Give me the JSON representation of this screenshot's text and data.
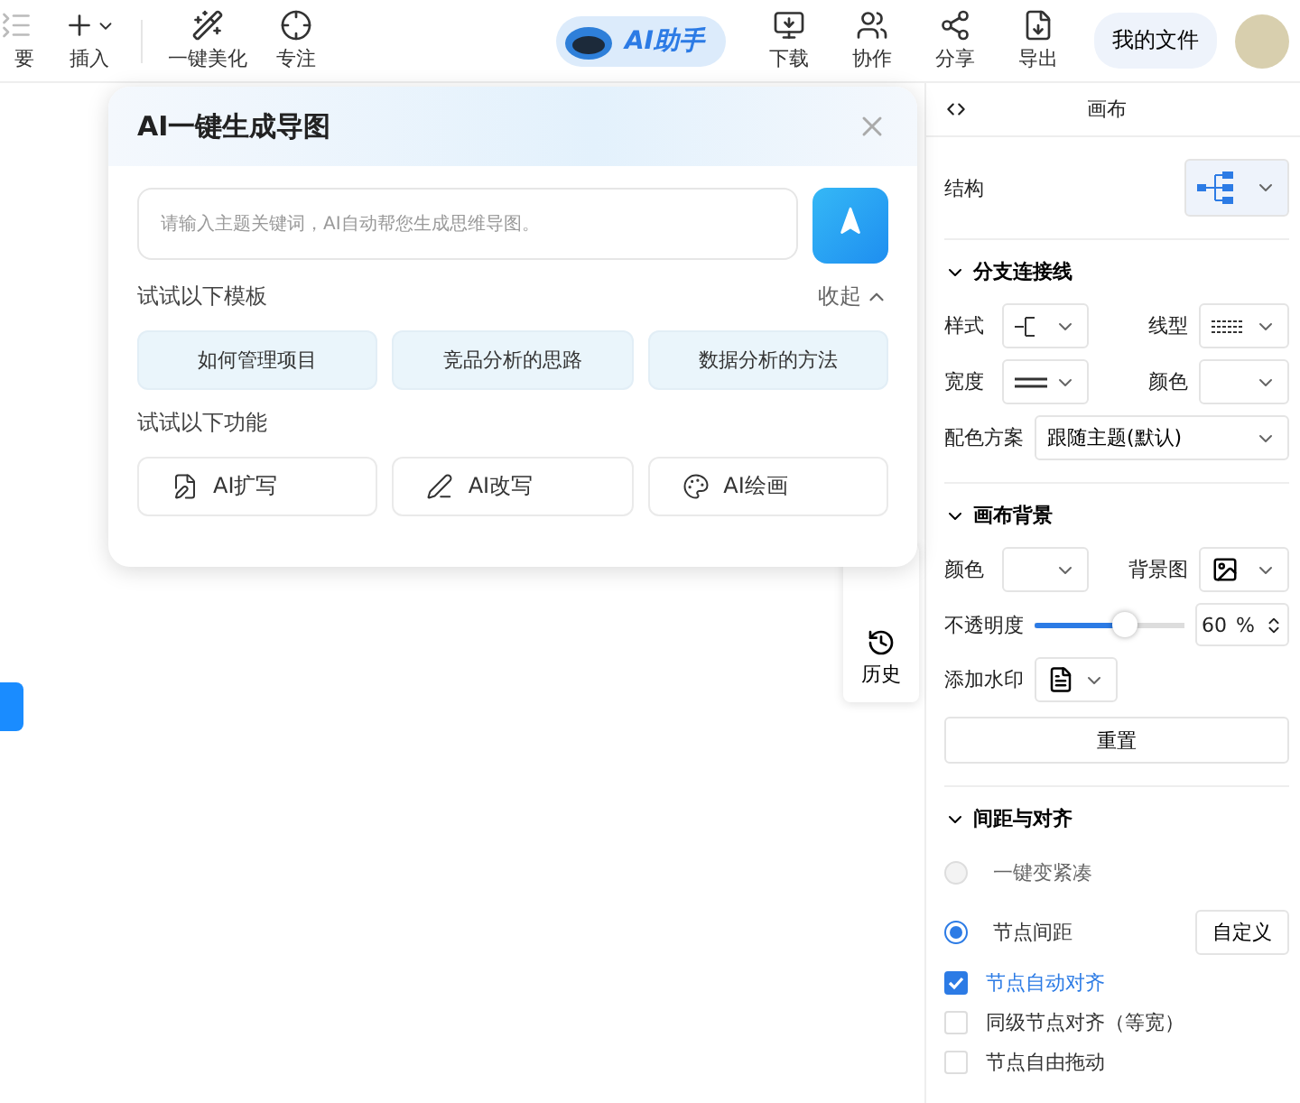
{
  "toolbar": {
    "left_items": [
      {
        "label": "要"
      },
      {
        "label": "插入"
      },
      {
        "label": "一键美化"
      },
      {
        "label": "专注"
      }
    ],
    "ai_button": {
      "label": "AI助手"
    },
    "right_items": [
      {
        "label": "下载"
      },
      {
        "label": "协作"
      },
      {
        "label": "分享"
      },
      {
        "label": "导出"
      }
    ],
    "files_button": "我的文件"
  },
  "ai_dialog": {
    "title": "AI一键生成导图",
    "prompt": {
      "placeholder": "请输入主题关键词，AI自动帮您生成思维导图。"
    },
    "templates_heading": "试试以下模板",
    "collapse": "收起",
    "templates": [
      "如何管理项目",
      "竞品分析的思路",
      "数据分析的方法"
    ],
    "features_heading": "试试以下功能",
    "features": [
      {
        "label": "AI扩写"
      },
      {
        "label": "AI改写"
      },
      {
        "label": "AI绘画"
      }
    ]
  },
  "side_dock": {
    "items": [
      {
        "label": "历史"
      }
    ]
  },
  "panel": {
    "title": "画布",
    "structure_label": "结构",
    "branch": {
      "heading": "分支连接线",
      "expanded": true,
      "style_label": "样式",
      "line_type_label": "线型",
      "width_label": "宽度",
      "color_label": "颜色",
      "scheme_label": "配色方案",
      "scheme_value": "跟随主题(默认)"
    },
    "background": {
      "heading": "画布背景",
      "expanded": true,
      "color_label": "颜色",
      "image_label": "背景图",
      "opacity_label": "不透明度",
      "opacity": {
        "level": 0.6,
        "value": "60"
      },
      "unit": "%",
      "watermark_label": "添加水印",
      "reset": "重置"
    },
    "spacing": {
      "heading": "间距与对齐",
      "expanded": true,
      "options": [
        {
          "label": "一键变紧凑",
          "selected": false,
          "disabled": true
        },
        {
          "label": "节点间距",
          "selected": true,
          "disabled": false
        }
      ],
      "custom": "自定义",
      "checks": [
        {
          "label": "节点自动对齐",
          "checked": true
        },
        {
          "label": "同级节点对齐（等宽）",
          "checked": false
        },
        {
          "label": "节点自由拖动",
          "checked": false
        }
      ]
    }
  }
}
